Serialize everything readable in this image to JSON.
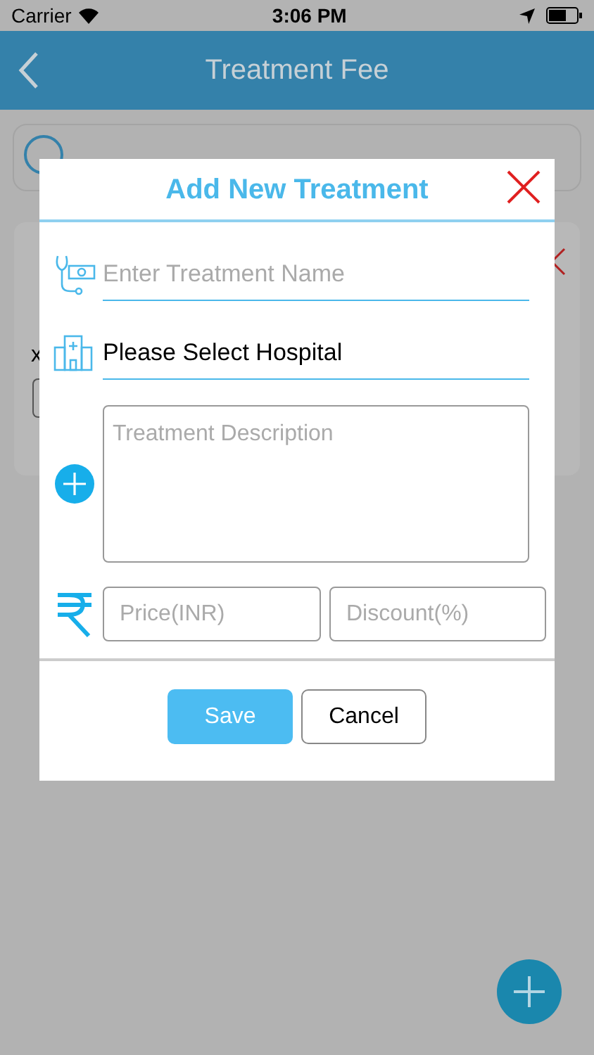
{
  "status_bar": {
    "carrier": "Carrier",
    "time": "3:06 PM"
  },
  "nav_bar": {
    "title": "Treatment Fee"
  },
  "card": {
    "line_3": "x"
  },
  "dialog": {
    "title": "Add New Treatment",
    "name_field": {
      "placeholder": "Enter Treatment Name"
    },
    "hospital_select": {
      "value": "Please Select Hospital"
    },
    "description": {
      "placeholder": "Treatment Description"
    },
    "price_field": {
      "placeholder": "Price(INR)"
    },
    "discount_field": {
      "placeholder": "Discount(%)"
    },
    "buttons": [
      {
        "label": "Save",
        "kind": "primary"
      },
      {
        "label": "Cancel",
        "kind": "secondary"
      }
    ]
  }
}
